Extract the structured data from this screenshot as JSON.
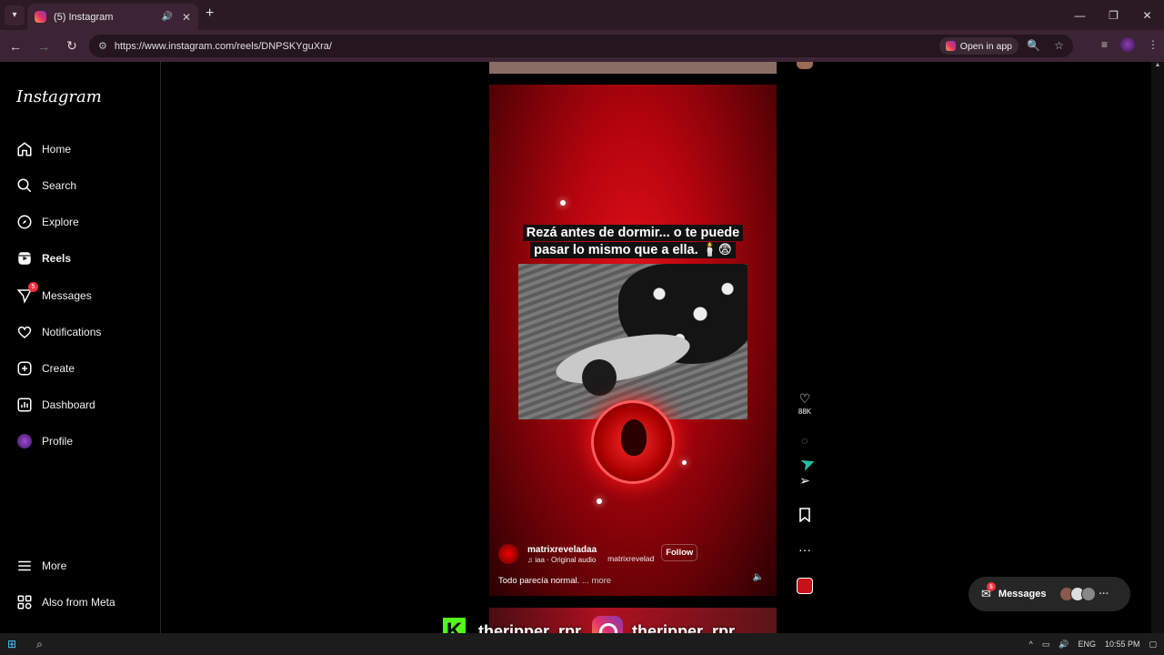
{
  "browser": {
    "tab_title": "(5) Instagram",
    "url": "https://www.instagram.com/reels/DNPSKYguXra/",
    "open_in_app": "Open in app"
  },
  "sidebar": {
    "logo": "Instagram",
    "items": [
      {
        "label": "Home",
        "icon": "home-icon"
      },
      {
        "label": "Search",
        "icon": "search-icon"
      },
      {
        "label": "Explore",
        "icon": "compass-icon"
      },
      {
        "label": "Reels",
        "icon": "reels-icon"
      },
      {
        "label": "Messages",
        "icon": "messenger-icon",
        "badge": "5"
      },
      {
        "label": "Notifications",
        "icon": "heart-icon"
      },
      {
        "label": "Create",
        "icon": "plus-square-icon"
      },
      {
        "label": "Dashboard",
        "icon": "dashboard-icon"
      },
      {
        "label": "Profile",
        "icon": "avatar"
      }
    ],
    "more": "More",
    "also_from_meta": "Also from Meta"
  },
  "reel": {
    "caption_line1": "Rezá antes de dormir... o te puede",
    "caption_line2": "pasar lo mismo que a ella. 🕯️😨",
    "username": "matrixreveladaa",
    "audio": "♫ iaa · Original audio",
    "audio_user": "matrixrevelad",
    "follow": "Follow",
    "description": "Todo parecía normal.",
    "more": "... more"
  },
  "actions": {
    "likes": "88K"
  },
  "messages_pill": {
    "label": "Messages",
    "badge": "5"
  },
  "overlay": {
    "kick_name": "theripper_rpr",
    "ig_name": "theripper_rpr"
  },
  "taskbar": {
    "lang": "ENG",
    "time": "10:55 PM"
  },
  "colors": {
    "ig_badge": "#ff3040",
    "kick_green": "#53fc18",
    "reel_red": "#d0081a"
  }
}
